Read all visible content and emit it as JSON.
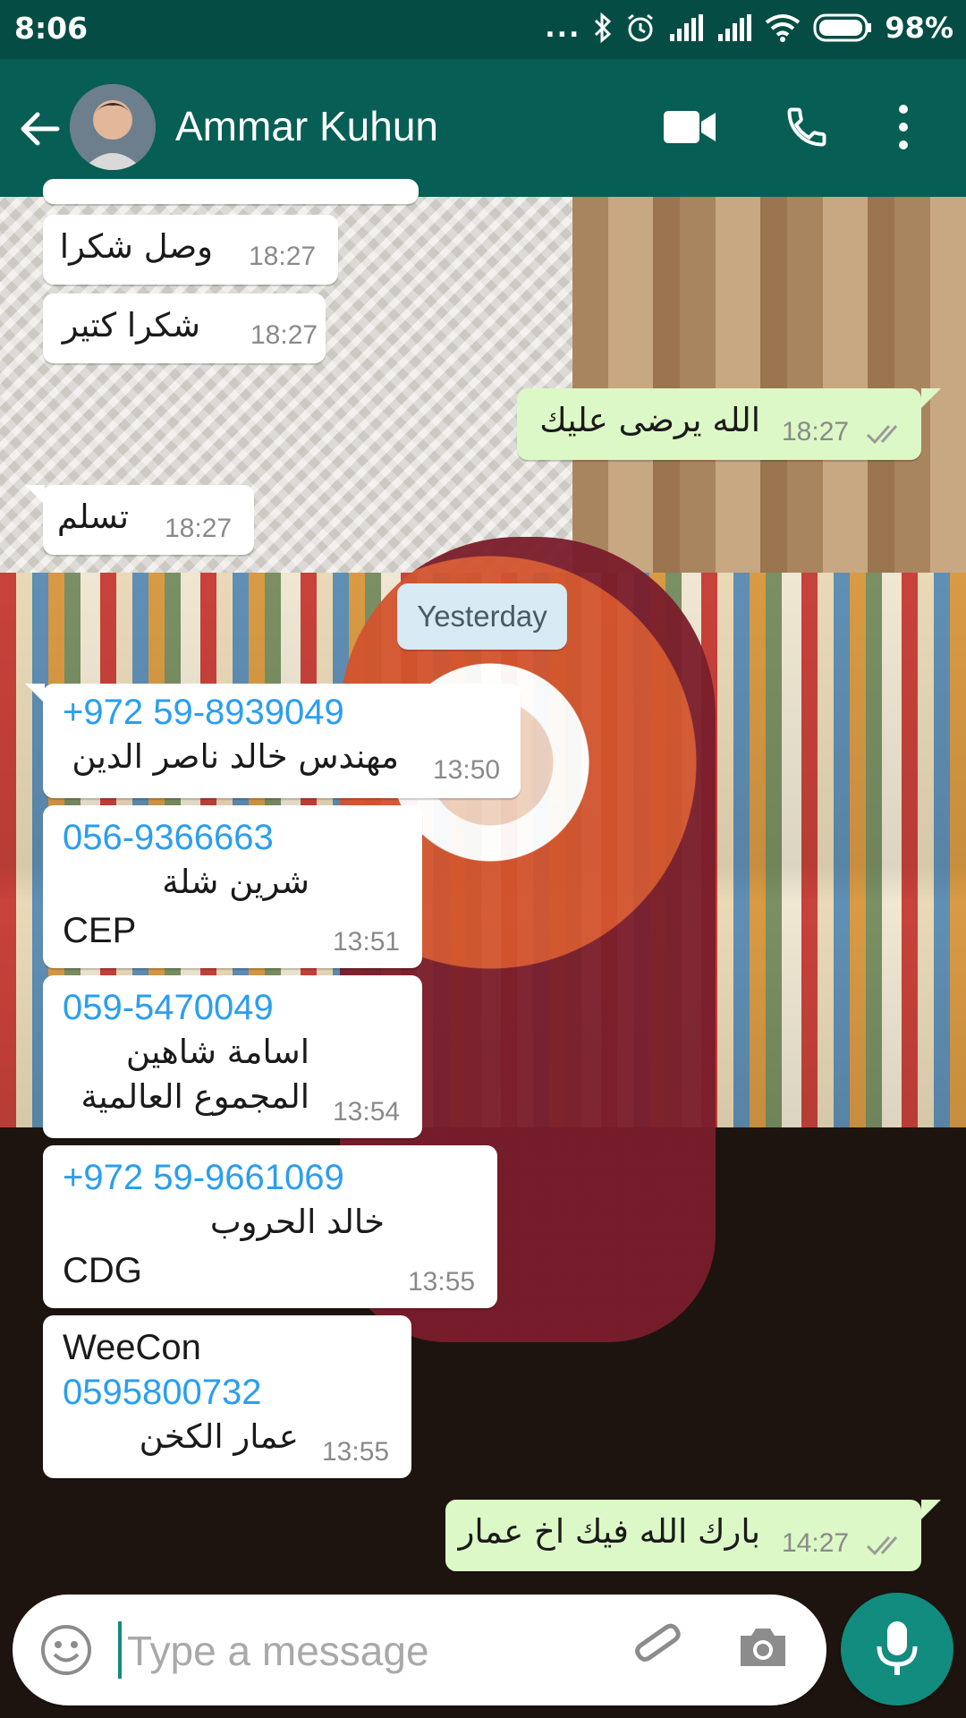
{
  "status_bar": {
    "time": "8:06",
    "dots": "...",
    "battery": "98%"
  },
  "header": {
    "contact_name": "Ammar Kuhun"
  },
  "messages": [
    {
      "dir": "in",
      "text": "وصل شكرا",
      "time": "18:27"
    },
    {
      "dir": "in",
      "text": "شكرا كتير",
      "time": "18:27"
    },
    {
      "dir": "out",
      "text": "الله يرضى عليك",
      "time": "18:27"
    },
    {
      "dir": "in",
      "text": "تسلم",
      "time": "18:27"
    }
  ],
  "date_divider": "Yesterday",
  "contacts": [
    {
      "phone": "+972 59-8939049",
      "line2": "مهندس خالد ناصر الدين",
      "time": "13:50"
    },
    {
      "phone": "056-9366663",
      "line2": "شرين شلة",
      "line3": "CEP",
      "time": "13:51"
    },
    {
      "phone": "059-5470049",
      "line2": "اسامة شاهين",
      "line3": "المجموع العالمية",
      "time": "13:54"
    },
    {
      "phone": "+972 59-9661069",
      "line2": "خالد الحروب",
      "line3": "CDG",
      "time": "13:55"
    },
    {
      "line1": "WeeCon",
      "phone": "0595800732",
      "line3": "عمار الكخن",
      "time": "13:55"
    }
  ],
  "last_message": {
    "dir": "out",
    "text": "بارك الله فيك اخ عمار",
    "time": "14:27"
  },
  "composer": {
    "placeholder": "Type a message"
  },
  "icons": {
    "back": "arrow-left-icon",
    "video": "video-camera-icon",
    "call": "phone-icon",
    "more": "more-vertical-icon",
    "emoji": "emoji-icon",
    "attach": "paperclip-icon",
    "camera": "camera-icon",
    "mic": "microphone-icon"
  },
  "colors": {
    "header": "#075e54",
    "status_bar": "#054d44",
    "outgoing_bubble": "#dcf8c6",
    "link": "#2a9ef0",
    "fab": "#128c7e"
  }
}
